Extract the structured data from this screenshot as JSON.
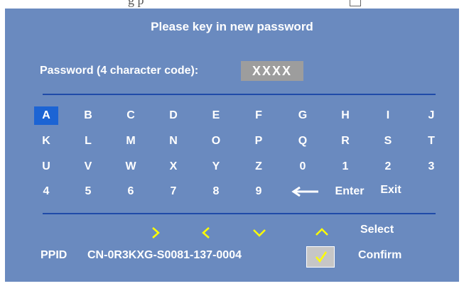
{
  "top_fragment": {
    "text": "g         p"
  },
  "dialog": {
    "title": "Please key in new password",
    "password_label": "Password (4 character code):",
    "password_value": "XXXX",
    "selected_key": "A"
  },
  "keyboard": {
    "rows": [
      [
        "A",
        "B",
        "C",
        "D",
        "E",
        "F",
        "G",
        "H",
        "I",
        "J"
      ],
      [
        "K",
        "L",
        "M",
        "N",
        "O",
        "P",
        "Q",
        "R",
        "S",
        "T"
      ],
      [
        "U",
        "V",
        "W",
        "X",
        "Y",
        "Z",
        "0",
        "1",
        "2",
        "3"
      ],
      [
        "4",
        "5",
        "6",
        "7",
        "8",
        "9"
      ]
    ],
    "backspace_icon": "left-arrow-icon",
    "enter_label": "Enter",
    "exit_label": "Exit"
  },
  "footer": {
    "nav_icons": [
      "chevron-right-icon",
      "chevron-left-icon",
      "chevron-down-icon",
      "chevron-up-icon"
    ],
    "select_label": "Select",
    "ppid_label": "PPID",
    "ppid_value": "CN-0R3KXG-S0081-137-0004",
    "confirm_icon": "checkmark-icon",
    "confirm_label": "Confirm"
  },
  "colors": {
    "panel_bg": "#6a8abf",
    "divider": "#1f4aa8",
    "selected_key_bg": "#1c64d4",
    "password_box_bg": "#9d9d9d",
    "nav_icon": "#ffff00",
    "text": "#ffffff"
  }
}
